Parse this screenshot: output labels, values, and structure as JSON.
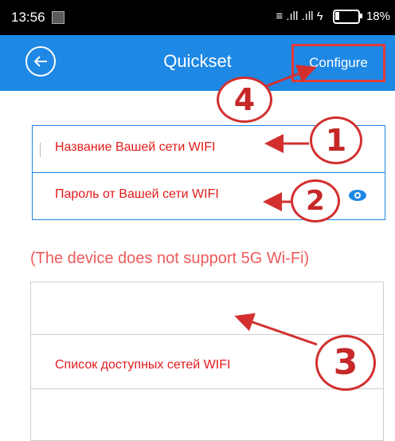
{
  "status_bar": {
    "time": "13:56",
    "signal": "≡ .ıll .ıll ϟ",
    "battery_percent": "18%",
    "battery_level": 0.18
  },
  "app_bar": {
    "title": "Quickset",
    "configure_label": "Configure",
    "back_icon": "back-arrow-circle-icon"
  },
  "fields": {
    "network_name": "Название Вашей сети WIFI",
    "password": "Пароль от Вашей сети WIFI",
    "eye_icon": "eye-icon"
  },
  "notice": "(The device does not support 5G Wi-Fi)",
  "network_list": {
    "label": "Список доступных сетей WIFI"
  },
  "annotations": [
    "1",
    "2",
    "3",
    "4"
  ],
  "colors": {
    "app_bar": "#1e88e5",
    "annotation_red": "#d32f2f",
    "label_red": "#e21b1b"
  }
}
